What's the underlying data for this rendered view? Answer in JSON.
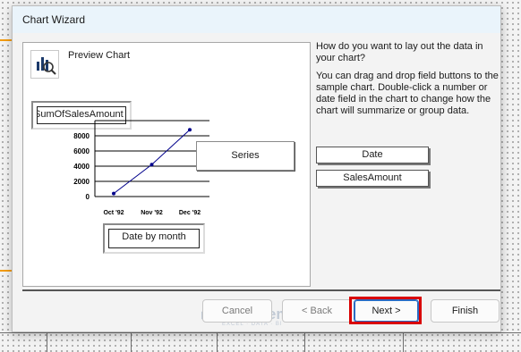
{
  "window": {
    "title": "Chart Wizard"
  },
  "preview": {
    "label": "Preview Chart",
    "data_field": "SumOfSalesAmount",
    "series_field": "Series",
    "axis_field": "Date by month"
  },
  "chart_data": {
    "type": "line",
    "categories": [
      "Oct '92",
      "Nov '92",
      "Dec '92"
    ],
    "series": [
      {
        "values": [
          400,
          4200,
          8800
        ]
      }
    ],
    "ylim": [
      0,
      8000
    ],
    "yticks": [
      0,
      2000,
      4000,
      6000,
      8000
    ],
    "grid": true
  },
  "instructions": {
    "question": "How do you want to lay out the data in your chart?",
    "help": "You can drag and drop field buttons to the sample chart. Double-click a number or date field in the chart to change how the chart will summarize or group data."
  },
  "fields": [
    "Date",
    "SalesAmount"
  ],
  "buttons": {
    "cancel": "Cancel",
    "back": "< Back",
    "next": "Next >",
    "finish": "Finish"
  },
  "watermark": {
    "name": "exceldemy",
    "tagline": "EXCEL · DATA · BI"
  },
  "colors": {
    "line": "#00008b",
    "highlight": "#d90000",
    "accent": "#f39c12",
    "primary_border": "#2b6cc4"
  }
}
